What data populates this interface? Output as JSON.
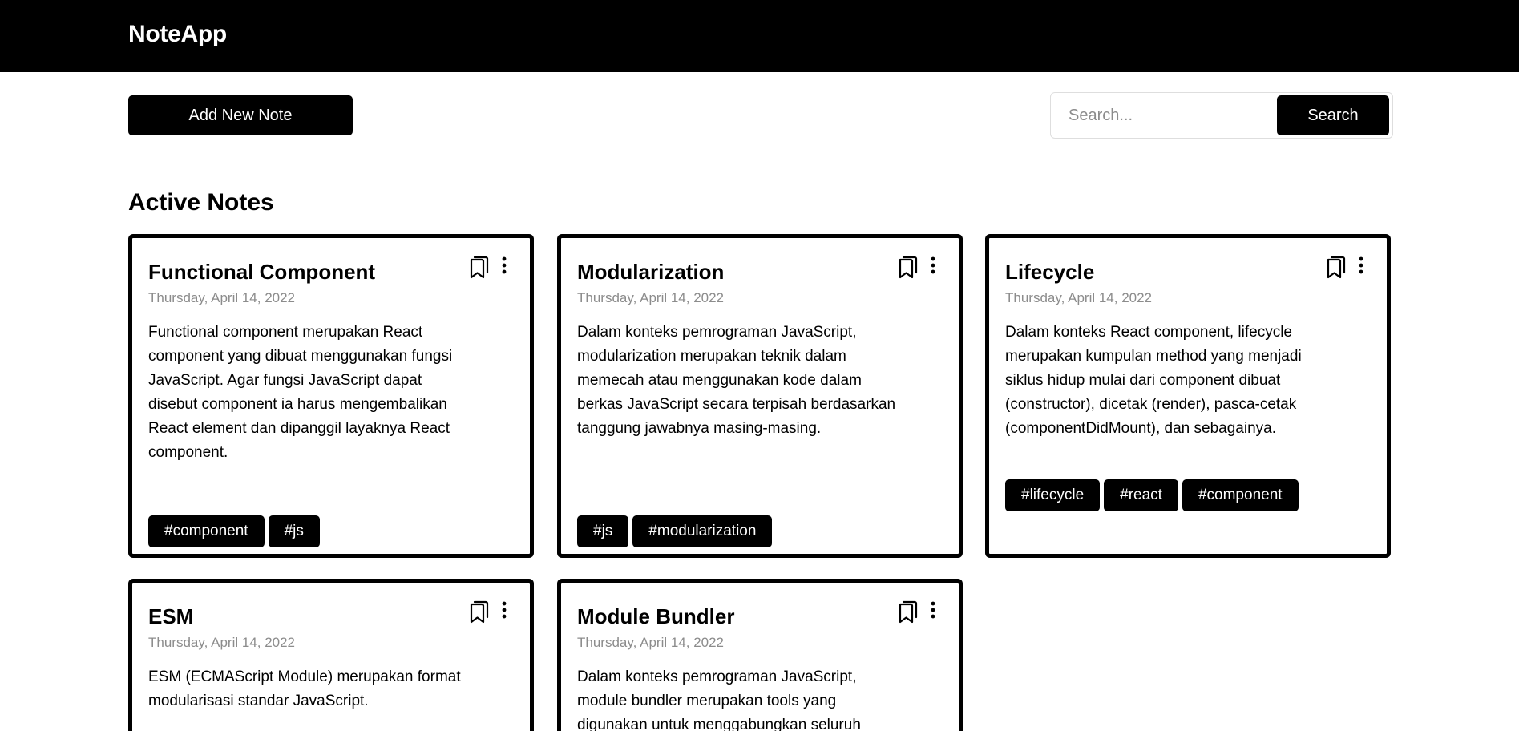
{
  "app": {
    "title": "NoteApp"
  },
  "toolbar": {
    "add_label": "Add New Note"
  },
  "search": {
    "placeholder": "Search...",
    "button_label": "Search"
  },
  "section": {
    "title": "Active Notes"
  },
  "notes": [
    {
      "title": "Functional Component",
      "date": "Thursday, April 14, 2022",
      "body": "Functional component merupakan React component yang dibuat menggunakan fungsi JavaScript. Agar fungsi JavaScript dapat disebut component ia harus mengembalikan React element dan dipanggil layaknya React component.",
      "tags": [
        "#component",
        "#js"
      ]
    },
    {
      "title": "Modularization",
      "date": "Thursday, April 14, 2022",
      "body": "Dalam konteks pemrograman JavaScript, modularization merupakan teknik dalam memecah atau menggunakan kode dalam berkas JavaScript secara terpisah berdasarkan tanggung jawabnya masing-masing.",
      "tags": [
        "#js",
        "#modularization"
      ]
    },
    {
      "title": "Lifecycle",
      "date": "Thursday, April 14, 2022",
      "body": "Dalam konteks React component, lifecycle merupakan kumpulan method yang menjadi siklus hidup mulai dari component dibuat (constructor), dicetak (render), pasca-cetak (componentDidMount), dan sebagainya.",
      "tags": [
        "#lifecycle",
        "#react",
        "#component"
      ]
    },
    {
      "title": "ESM",
      "date": "Thursday, April 14, 2022",
      "body": "ESM (ECMAScript Module) merupakan format modularisasi standar JavaScript.",
      "tags": []
    },
    {
      "title": "Module Bundler",
      "date": "Thursday, April 14, 2022",
      "body": "Dalam konteks pemrograman JavaScript, module bundler merupakan tools yang digunakan untuk menggabungkan seluruh",
      "tags": []
    }
  ],
  "icons": {
    "archive": "archive-book-icon",
    "menu": "more-vertical-icon"
  },
  "colors": {
    "header_bg": "#000000",
    "accent": "#000000",
    "muted_text": "#8c8c8c"
  }
}
